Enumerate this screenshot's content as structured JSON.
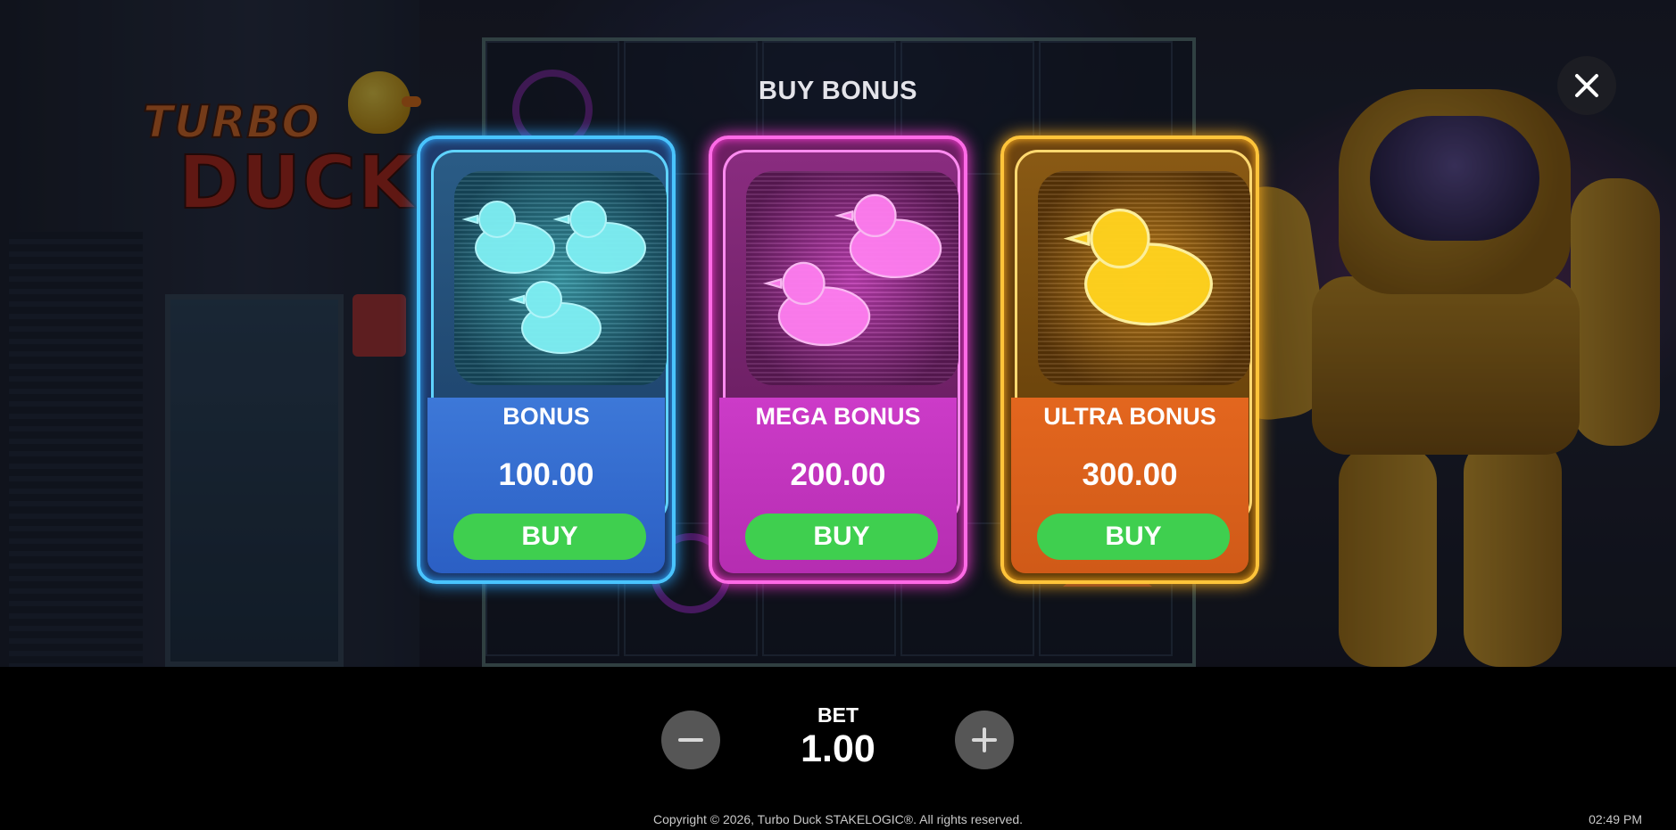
{
  "modal": {
    "title": "BUY BONUS",
    "close_icon": "close-icon"
  },
  "bonuses": [
    {
      "name": "BONUS",
      "price": "100.00",
      "buy_label": "BUY",
      "accent": "#49c4ff",
      "duck_count": 3
    },
    {
      "name": "MEGA BONUS",
      "price": "200.00",
      "buy_label": "BUY",
      "accent": "#ff6ae6",
      "duck_count": 2
    },
    {
      "name": "ULTRA BONUS",
      "price": "300.00",
      "buy_label": "BUY",
      "accent": "#ffc43a",
      "duck_count": 1
    }
  ],
  "bet": {
    "label": "BET",
    "value": "1.00",
    "decrease_icon": "minus-icon",
    "increase_icon": "plus-icon"
  },
  "footer": {
    "copyright": "Copyright © 2026, Turbo Duck STAKELOGIC®. All rights reserved.",
    "clock": "02:49 PM"
  },
  "logo": {
    "line1": "TURBO",
    "line2": "DUCK"
  },
  "colors": {
    "buy_button": "#3fcf4f",
    "background": "#000000"
  }
}
